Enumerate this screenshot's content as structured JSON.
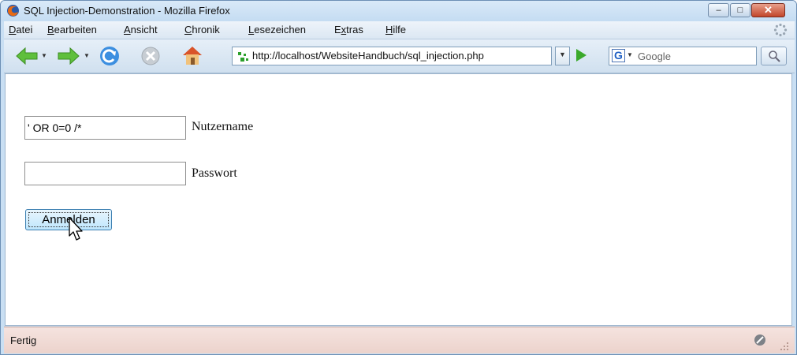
{
  "window": {
    "title": "SQL Injection-Demonstration - Mozilla Firefox",
    "buttons": {
      "minimize": "–",
      "maximize": "□",
      "close": "✕"
    }
  },
  "menubar": {
    "items": [
      {
        "label": "Datei"
      },
      {
        "label": "Bearbeiten"
      },
      {
        "label": "Ansicht"
      },
      {
        "label": "Chronik"
      },
      {
        "label": "Lesezeichen"
      },
      {
        "label": "Extras"
      },
      {
        "label": "Hilfe"
      }
    ]
  },
  "navbar": {
    "url": "http://localhost/WebsiteHandbuch/sql_injection.php",
    "search_engine": "G",
    "search_placeholder": "Google"
  },
  "form": {
    "username": {
      "value": "' OR 0=0 /*",
      "label": "Nutzername"
    },
    "password": {
      "value": "",
      "label": "Passwort"
    },
    "submit_label": "Anmelden"
  },
  "status": {
    "text": "Fertig"
  },
  "colors": {
    "titlebar": "#c9dff3",
    "close_button": "#c2462a",
    "statusbar": "#f5e3df",
    "button_face": "#bee6fd"
  }
}
